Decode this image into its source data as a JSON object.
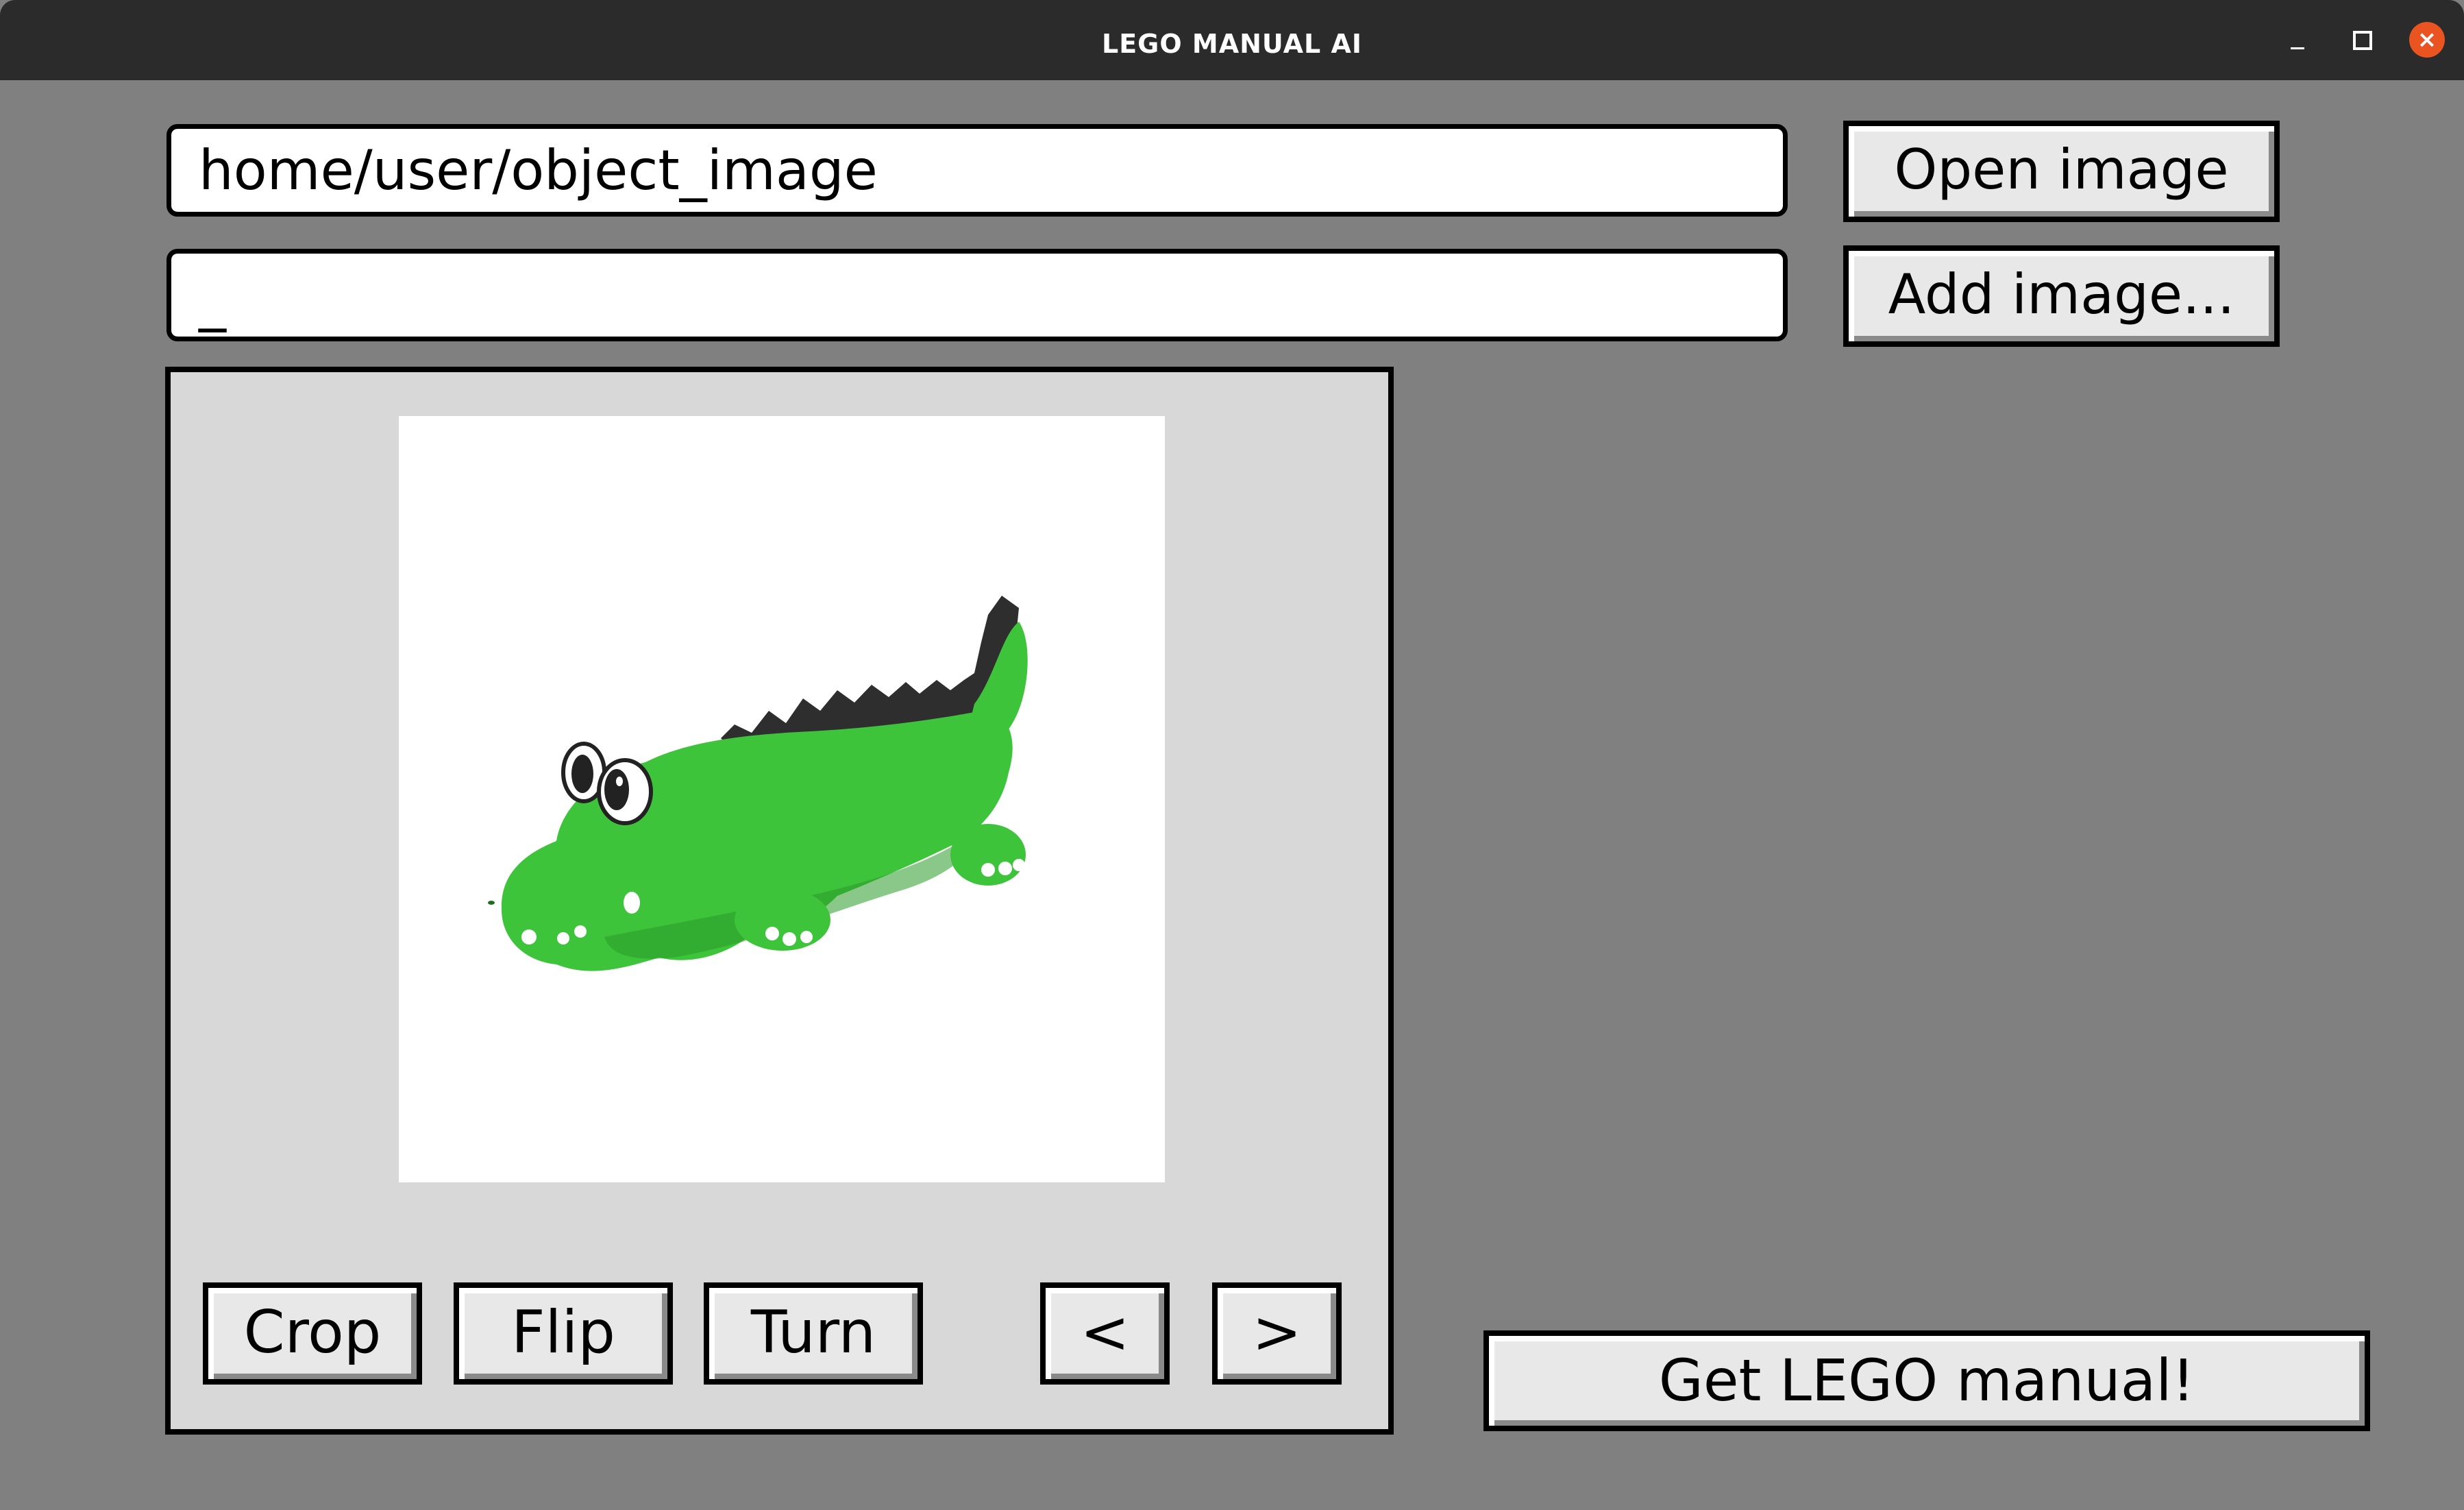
{
  "window": {
    "title": "LEGO MANUAL AI",
    "close_glyph": "×"
  },
  "inputs": {
    "path_value": "home/user/object_image",
    "second_value": "_"
  },
  "buttons": {
    "open_image": "Open image",
    "add_image": "Add image...",
    "crop": "Crop",
    "flip": "Flip",
    "turn": "Turn",
    "prev": "<",
    "next": ">",
    "get_manual": "Get LEGO manual!"
  },
  "preview": {
    "subject": "green toy crocodile icon",
    "colors": {
      "body": "#3ec43a",
      "body_dark": "#2a9a2a",
      "spikes": "#2e2e2e",
      "background": "#ffffff",
      "panel": "#d8d8d8",
      "window_bg": "#808080",
      "titlebar": "#2b2b2b",
      "close_button": "#e95420"
    }
  }
}
